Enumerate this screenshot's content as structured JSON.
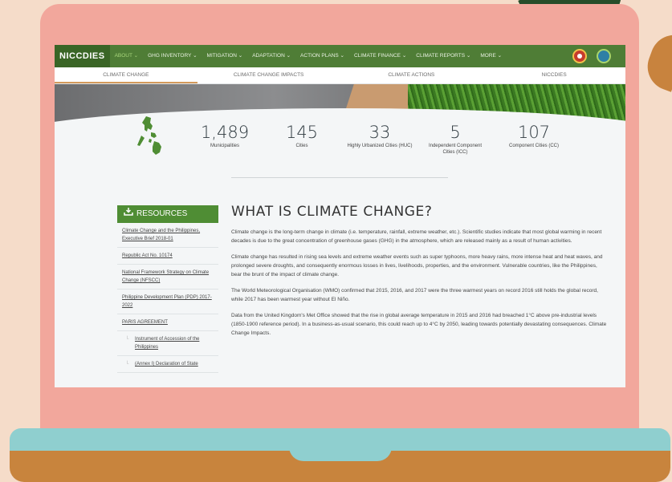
{
  "nav": {
    "brand": "NICCDIES",
    "items": [
      {
        "label": "ABOUT ⌄",
        "active": true
      },
      {
        "label": "GHG INVENTORY ⌄",
        "active": false
      },
      {
        "label": "MITIGATION ⌄",
        "active": false
      },
      {
        "label": "ADAPTATION ⌄",
        "active": false
      },
      {
        "label": "ACTION PLANS ⌄",
        "active": false
      },
      {
        "label": "CLIMATE FINANCE ⌄",
        "active": false
      },
      {
        "label": "CLIMATE REPORTS ⌄",
        "active": false
      },
      {
        "label": "MORE ⌄",
        "active": false
      }
    ]
  },
  "subnav": {
    "items": [
      "CLIMATE CHANGE",
      "CLIMATE CHANGE IMPACTS",
      "CLIMATE ACTIONS",
      "NICCDIES"
    ]
  },
  "stats": [
    {
      "value": "1,489",
      "label": "Municipalities"
    },
    {
      "value": "145",
      "label": "Cities"
    },
    {
      "value": "33",
      "label": "Highly Urbanized Cities (HUC)"
    },
    {
      "value": "5",
      "label": "Independent Component Cities (ICC)"
    },
    {
      "value": "107",
      "label": "Component Cities (CC)"
    }
  ],
  "resources": {
    "title": "RESOURCES",
    "items": [
      {
        "label": "Climate Change and the Philippines, Executive Brief 2018-01",
        "sub": false
      },
      {
        "label": "Republic Act No. 10174",
        "sub": false
      },
      {
        "label": "National Framework Strategy on Climate Change (NFSCC)",
        "sub": false
      },
      {
        "label": "Philippine Development Plan (PDP) 2017-2022",
        "sub": false
      },
      {
        "label": "PARIS AGREEMENT",
        "sub": false
      },
      {
        "label": "Instrument of Accession of the Philippines",
        "sub": true
      },
      {
        "label": "(Annex I) Declaration of State",
        "sub": true
      }
    ]
  },
  "article": {
    "title": "WHAT IS CLIMATE CHANGE?",
    "paragraphs": [
      "Climate change is the long-term change in climate (i.e. temperature, rainfall, extreme weather, etc.). Scientific studies indicate that most global warming in recent decades is due to the great concentration of greenhouse gases (GHG) in the atmosphere, which are released mainly as a result of human activities.",
      "Climate change has resulted in rising sea levels and extreme weather events such as super typhoons, more heavy rains, more intense heat and heat waves, and prolonged severe droughts, and consequently enormous losses in lives, livelihoods, properties, and the environment. Vulnerable countries, like the Philippines, bear the brunt of the impact of climate change.",
      "The World Meteorological Organisation (WMO) confirmed that 2015, 2016, and 2017 were the three warmest years on record 2016 still holds the global record, while 2017 has been warmest year without El Niño.",
      "Data from the United Kingdom's Met Office showed that the rise in global average temperature in 2015 and 2016 had breached 1°C above pre-industrial levels (1850-1900 reference period). In a business-as-usual scenario, this could reach up to 4°C by 2050, leading towards potentially devastating consequences. Climate Change Impacts."
    ]
  },
  "colors": {
    "nav_green": "#4f7d36",
    "resource_green": "#4f8d34",
    "laptop_pink": "#f2a79c",
    "laptop_teal": "#8fcfcf",
    "laptop_brown": "#c8843d"
  }
}
